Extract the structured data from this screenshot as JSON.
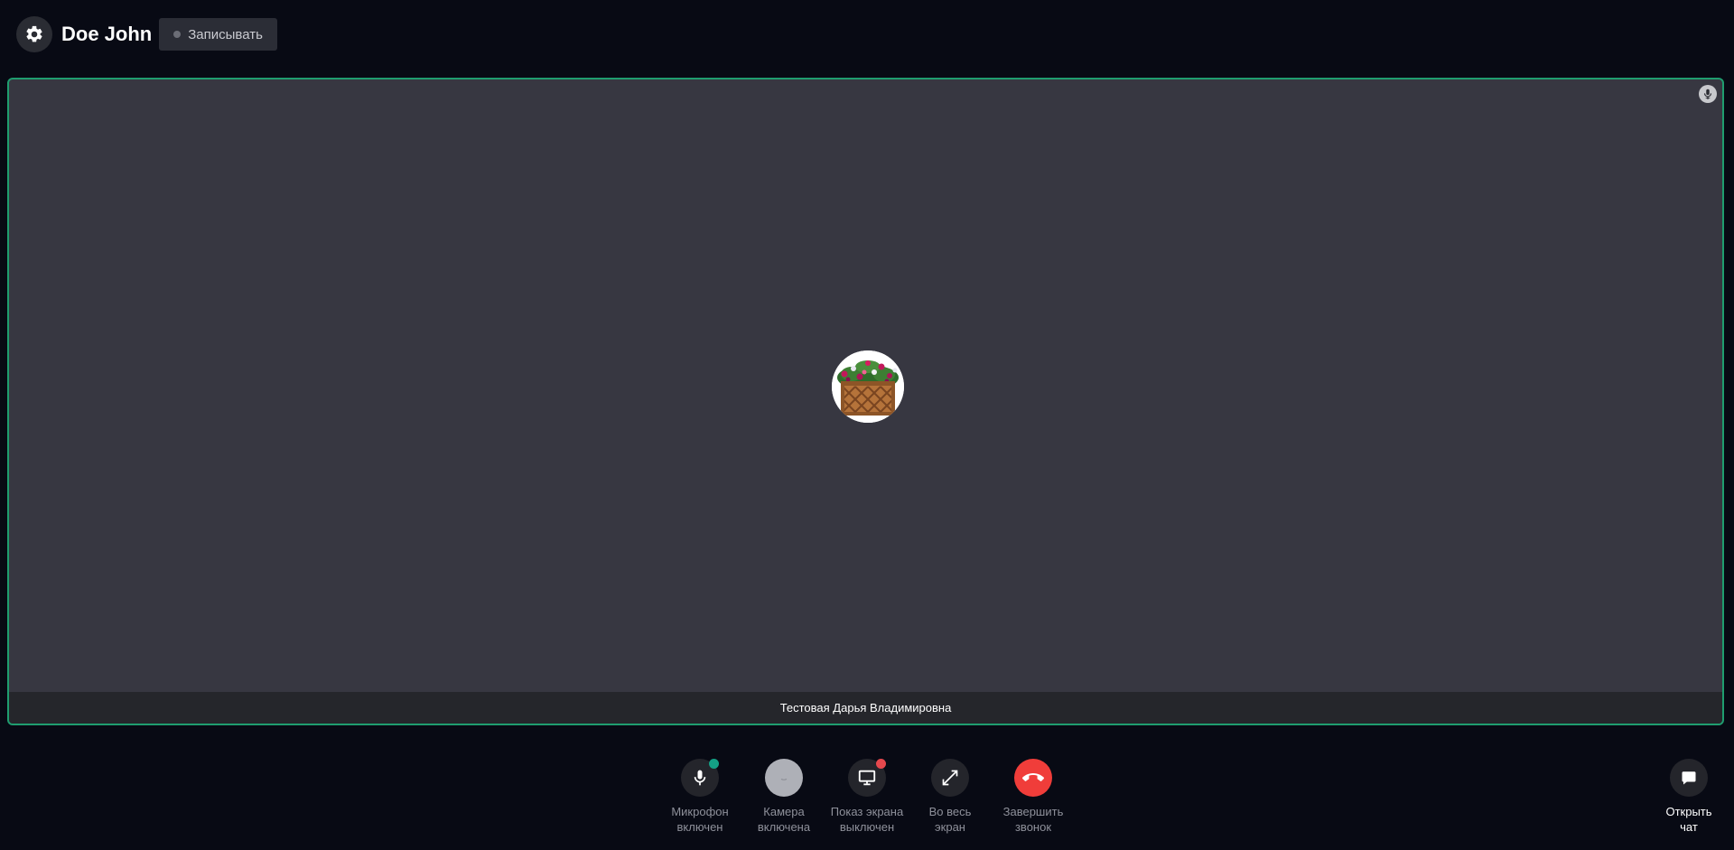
{
  "header": {
    "user_name": "Doe John",
    "record_label": "Записывать",
    "settings_icon": "gear-icon"
  },
  "tile": {
    "participant_name": "Тестовая Дарья Владимировна",
    "avatar": "flower-planter-avatar",
    "mic_indicator_icon": "mic-icon",
    "border_color": "#1f9d6f"
  },
  "controls": {
    "mic": {
      "line1": "Микрофон",
      "line2": "включен",
      "icon": "mic-icon",
      "status_color": "#14a085"
    },
    "camera": {
      "line1": "Камера",
      "line2": "включена",
      "icon": "camera-icon"
    },
    "screen": {
      "line1": "Показ экрана",
      "line2": "выключен",
      "icon": "monitor-icon",
      "status_color": "#e5484d"
    },
    "fullscreen": {
      "line1": "Во весь",
      "line2": "экран",
      "icon": "expand-icon"
    },
    "end_call": {
      "line1": "Завершить",
      "line2": "звонок",
      "icon": "phone-hangup-icon",
      "color": "#f03d3a"
    },
    "chat": {
      "line1": "Открыть",
      "line2": "чат",
      "icon": "chat-bubble-icon"
    }
  }
}
